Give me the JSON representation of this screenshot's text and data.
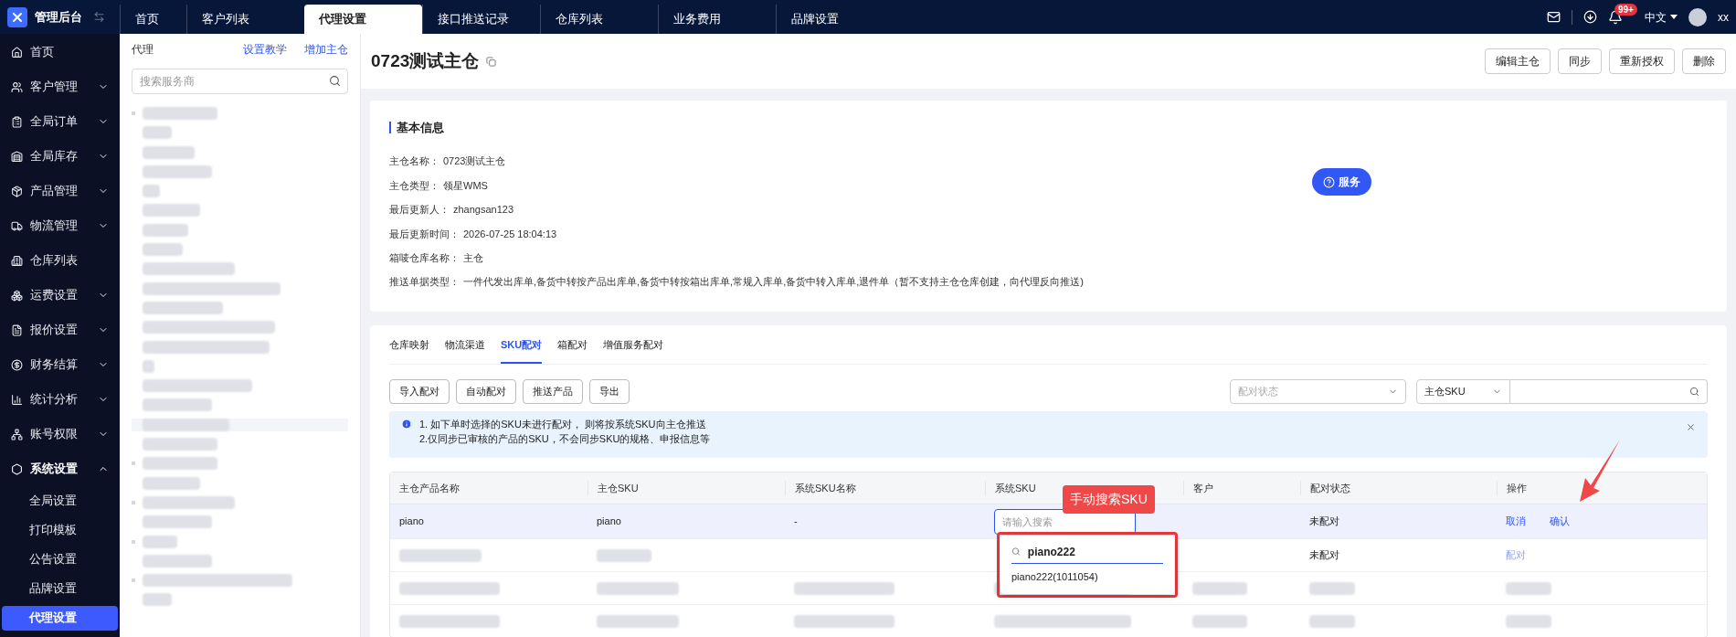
{
  "topbar": {
    "app_title": "管理后台",
    "tabs": [
      {
        "label": "首页",
        "selected": false
      },
      {
        "label": "客户列表",
        "selected": false
      },
      {
        "label": "代理设置",
        "selected": true
      },
      {
        "label": "接口推送记录",
        "selected": false
      },
      {
        "label": "仓库列表",
        "selected": false
      },
      {
        "label": "业务费用",
        "selected": false
      },
      {
        "label": "品牌设置",
        "selected": false
      }
    ],
    "notification_count": "99+",
    "language": "中文",
    "user": "xx"
  },
  "sidebar": {
    "items": [
      {
        "label": "首页",
        "expandable": false,
        "expanded": false
      },
      {
        "label": "客户管理",
        "expandable": true,
        "expanded": false
      },
      {
        "label": "全局订单",
        "expandable": true,
        "expanded": false
      },
      {
        "label": "全局库存",
        "expandable": true,
        "expanded": false
      },
      {
        "label": "产品管理",
        "expandable": true,
        "expanded": false
      },
      {
        "label": "物流管理",
        "expandable": true,
        "expanded": false
      },
      {
        "label": "仓库列表",
        "expandable": false,
        "expanded": false
      },
      {
        "label": "运费设置",
        "expandable": true,
        "expanded": false
      },
      {
        "label": "报价设置",
        "expandable": true,
        "expanded": false
      },
      {
        "label": "财务结算",
        "expandable": true,
        "expanded": false
      },
      {
        "label": "统计分析",
        "expandable": true,
        "expanded": false
      },
      {
        "label": "账号权限",
        "expandable": true,
        "expanded": false
      },
      {
        "label": "系统设置",
        "expandable": true,
        "expanded": true,
        "children": [
          {
            "label": "全局设置",
            "selected": false
          },
          {
            "label": "打印模板",
            "selected": false
          },
          {
            "label": "公告设置",
            "selected": false
          },
          {
            "label": "品牌设置",
            "selected": false
          },
          {
            "label": "代理设置",
            "selected": true
          }
        ]
      }
    ]
  },
  "agent_panel": {
    "title": "代理",
    "links": [
      "设置教学",
      "增加主仓"
    ],
    "search": {
      "placeholder": "搜索服务商"
    }
  },
  "page": {
    "title": "0723测试主仓",
    "buttons": [
      "编辑主仓",
      "同步",
      "重新授权",
      "删除"
    ]
  },
  "basic_info": {
    "heading": "基本信息",
    "fields": [
      {
        "label": "主仓名称：",
        "value": "0723测试主仓"
      },
      {
        "label": "主仓类型：",
        "value": "领星WMS"
      },
      {
        "label": "最后更新人：",
        "value": "zhangsan123"
      },
      {
        "label": "最后更新时间：",
        "value": "2026-07-25 18:04:13"
      },
      {
        "label": "箱唛仓库名称：",
        "value": "主仓"
      },
      {
        "label": "推送单据类型：",
        "value": "一件代发出库单,备货中转按产品出库单,备货中转按箱出库单,常规入库单,备货中转入库单,退件单（暂不支持主仓仓库创建，向代理反向推送)"
      }
    ],
    "service_button": "服务"
  },
  "pairing": {
    "tabs": [
      {
        "label": "仓库映射",
        "selected": false
      },
      {
        "label": "物流渠道",
        "selected": false
      },
      {
        "label": "SKU配对",
        "selected": true
      },
      {
        "label": "箱配对",
        "selected": false
      },
      {
        "label": "增值服务配对",
        "selected": false
      }
    ],
    "actions": [
      "导入配对",
      "自动配对",
      "推送产品",
      "导出"
    ],
    "status_filter": {
      "placeholder": "配对状态"
    },
    "search_type": "主仓SKU",
    "notice": [
      "1. 如下单时选择的SKU未进行配对， 则将按系统SKU向主仓推送",
      "2.仅同步已审核的产品的SKU，不会同步SKU的规格、申报信息等"
    ],
    "table": {
      "columns": [
        "主仓产品名称",
        "主仓SKU",
        "系统SKU名称",
        "系统SKU",
        "客户",
        "配对状态",
        "操作"
      ],
      "rows": [
        {
          "kind": "editing",
          "product_name": "piano",
          "sku": "piano",
          "system_sku_name": "-",
          "system_sku_placeholder": "请输入搜索",
          "status": "未配对",
          "actions": [
            "取消",
            "确认"
          ]
        },
        {
          "kind": "blurred",
          "status": "未配对",
          "actions": [
            "配对"
          ]
        },
        {
          "kind": "blurred_all"
        },
        {
          "kind": "blurred_all"
        }
      ],
      "dropdown": {
        "search_value": "piano222",
        "options": [
          "piano222(1011054)"
        ]
      }
    },
    "annotation": {
      "callout": "手动搜索SKU"
    }
  }
}
